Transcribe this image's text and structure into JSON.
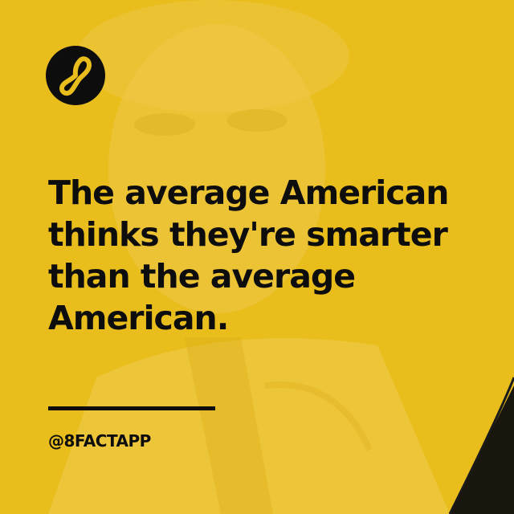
{
  "brand": {
    "logo_icon": "infinity-eight-icon",
    "accent_color": "#e8bd1c",
    "ink_color": "#0d0d0d"
  },
  "post": {
    "headline_lines": [
      "The average American",
      "thinks they're smarter",
      "than the average",
      "American."
    ],
    "handle": "@8FACTAPP"
  }
}
